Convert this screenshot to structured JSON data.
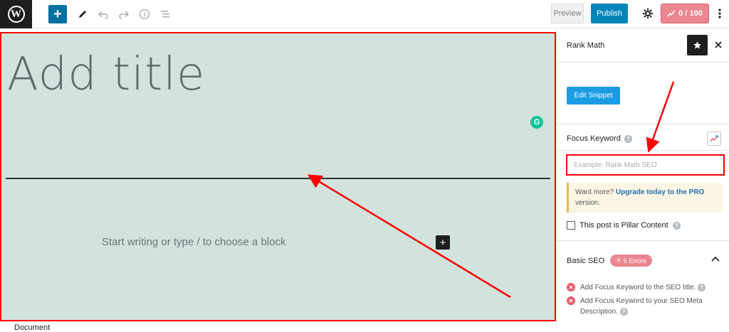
{
  "toolbar": {
    "logo_glyph": "W",
    "add_glyph": "+",
    "preview_label": "Preview",
    "publish_label": "Publish",
    "seo_score": "0 / 100"
  },
  "editor": {
    "title_placeholder": "Add title",
    "block_placeholder": "Start writing or type / to choose a block",
    "grammarly_glyph": "G",
    "add_block_glyph": "+",
    "document_label": "Document"
  },
  "sidebar": {
    "title": "Rank Math",
    "edit_snippet_label": "Edit Snippet",
    "focus_keyword_label": "Focus Keyword",
    "focus_keyword_placeholder": "Example: Rank Math SEO",
    "focus_keyword_value": "",
    "upgrade_prefix": "Want more? ",
    "upgrade_link": "Upgrade today to the PRO",
    "upgrade_suffix": " version.",
    "pillar_label": "This post is Pillar Content",
    "basic_seo_label": "Basic SEO",
    "errors_badge": "6 Errors",
    "checks": [
      "Add Focus Keyword to the SEO title.",
      "Add Focus Keyword to your SEO Meta Description."
    ]
  },
  "colors": {
    "editor_bg": "#d2e3dd",
    "highlight": "#ff0000",
    "publish": "#0085ba",
    "score": "#ea868f"
  }
}
